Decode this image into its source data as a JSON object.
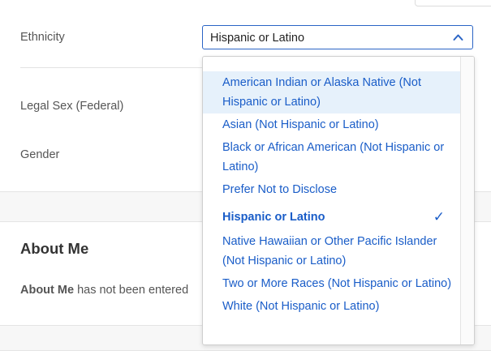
{
  "form": {
    "ethnicity_label": "Ethnicity",
    "legal_sex_label": "Legal Sex (Federal)",
    "gender_label": "Gender"
  },
  "ethnicity_select": {
    "value": "Hispanic or Latino",
    "icon": "chevron-up-icon",
    "options": [
      "American Indian or Alaska Native (Not Hispanic or Latino)",
      "Asian (Not Hispanic or Latino)",
      "Black or African American (Not Hispanic or Latino)",
      "Prefer Not to Disclose",
      "Hispanic or Latino",
      "Native Hawaiian or Other Pacific Islander (Not Hispanic or Latino)",
      "Two or More Races (Not Hispanic or Latino)",
      "White (Not Hispanic or Latino)"
    ],
    "highlighted_index": 0,
    "selected_index": 4,
    "check_glyph": "✓"
  },
  "about": {
    "title": "About Me",
    "label": "About Me",
    "rest": " has not been entered"
  },
  "colors": {
    "link_blue": "#1a5dc8",
    "select_border": "#2a64c5",
    "highlight_bg": "#e6f1fb"
  }
}
